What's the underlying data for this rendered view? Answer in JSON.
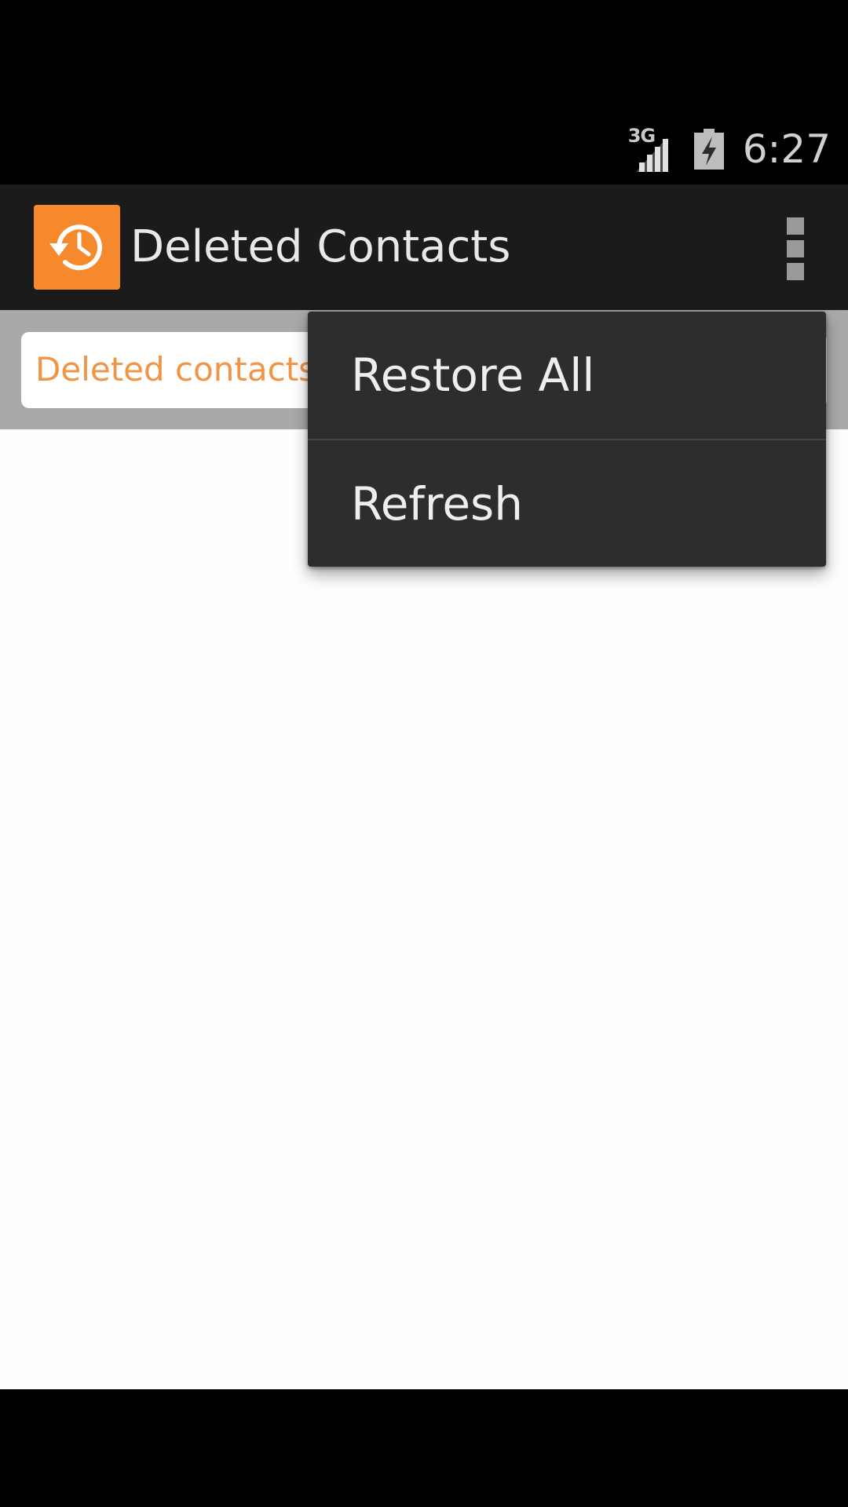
{
  "status_bar": {
    "network_type": "3G",
    "time": "6:27"
  },
  "action_bar": {
    "title": "Deleted Contacts",
    "app_icon": "history-clock-icon",
    "overflow_icon": "overflow-menu-icon"
  },
  "content": {
    "header_label": "Deleted contacts"
  },
  "overflow_menu": {
    "items": [
      {
        "label": "Restore All"
      },
      {
        "label": "Refresh"
      }
    ]
  },
  "colors": {
    "accent": "#f6892c",
    "action_bar": "#1b1b1b",
    "menu_background": "#2d2d2d",
    "header_band": "#a9a9a9"
  }
}
